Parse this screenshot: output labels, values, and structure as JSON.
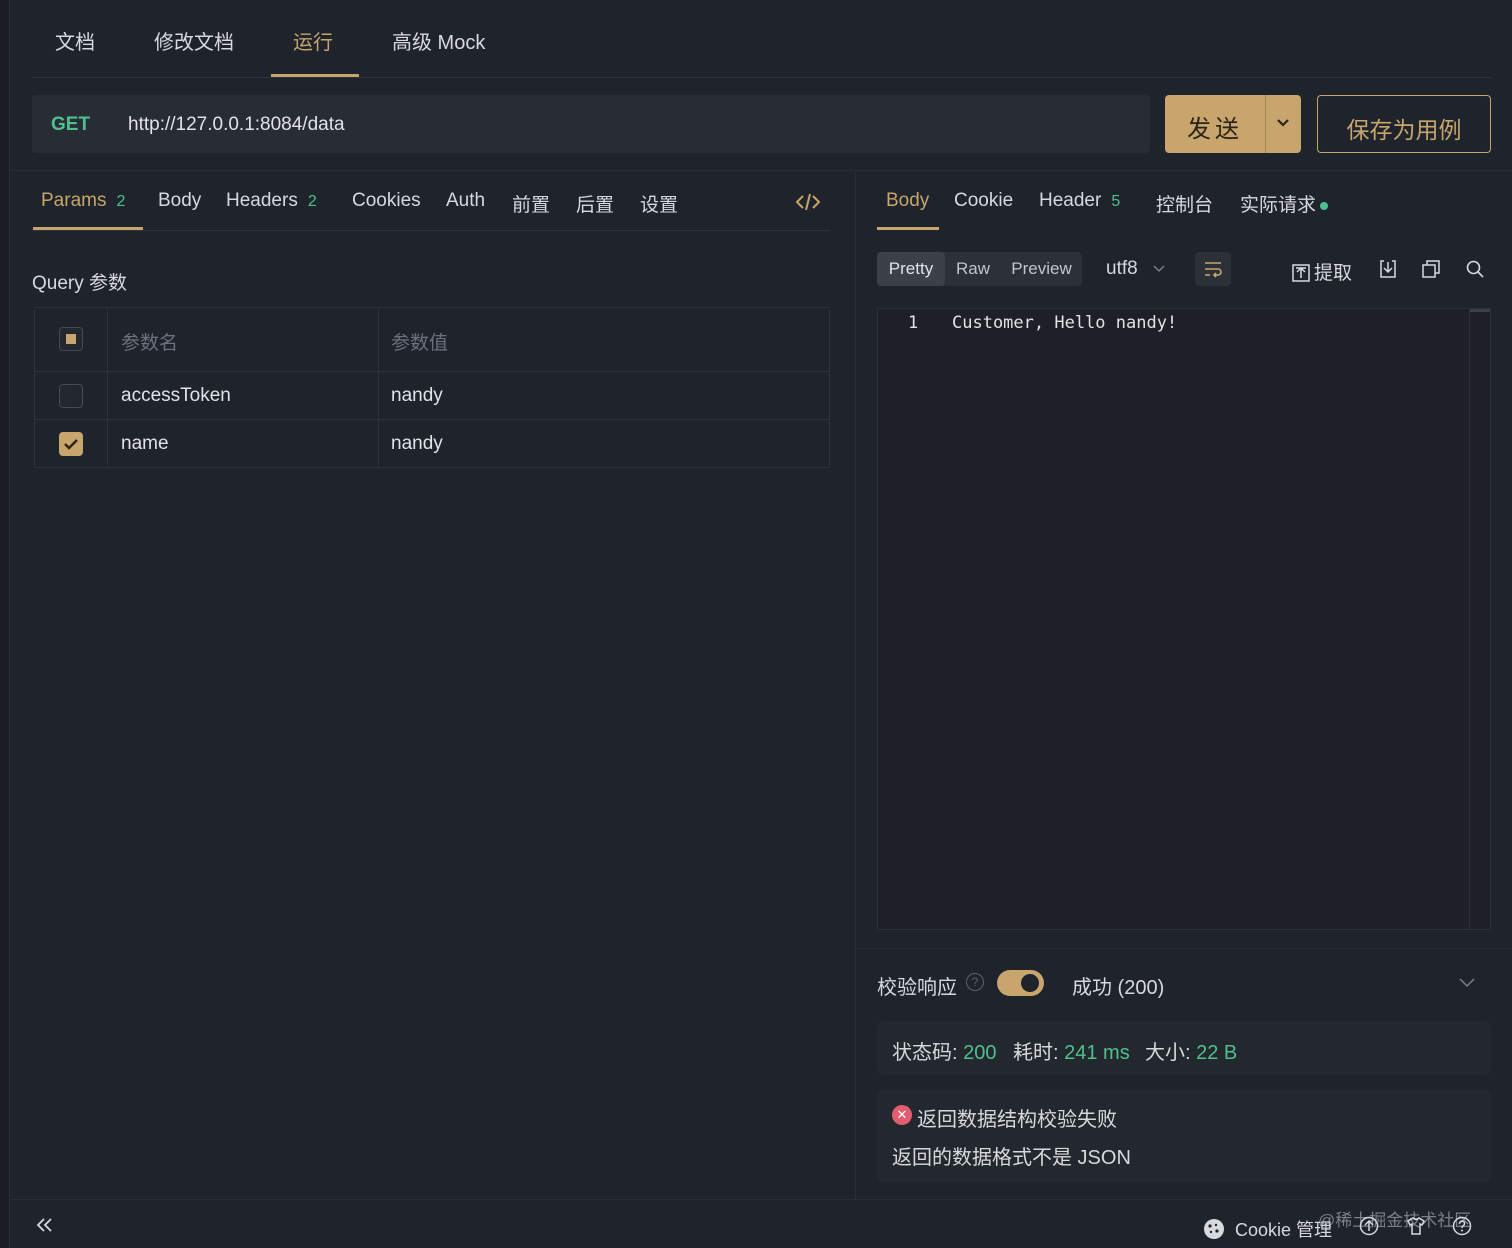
{
  "top_tabs": [
    "文档",
    "修改文档",
    "运行",
    "高级 Mock"
  ],
  "request": {
    "method": "GET",
    "url": "http://127.0.0.1:8084/data",
    "send_label": "发送",
    "save_label": "保存为用例"
  },
  "request_tabs": {
    "params": "Params",
    "params_count": "2",
    "body": "Body",
    "headers": "Headers",
    "headers_count": "2",
    "cookies": "Cookies",
    "auth": "Auth",
    "pre": "前置",
    "post": "后置",
    "settings": "设置"
  },
  "query": {
    "title": "Query 参数",
    "col_name": "参数名",
    "col_value": "参数值",
    "rows": [
      {
        "name": "accessToken",
        "value": "nandy",
        "checked": false
      },
      {
        "name": "name",
        "value": "nandy",
        "checked": true
      }
    ]
  },
  "response_tabs": {
    "body": "Body",
    "cookie": "Cookie",
    "header": "Header",
    "header_count": "5",
    "console": "控制台",
    "actual": "实际请求"
  },
  "toolbar": {
    "pretty": "Pretty",
    "raw": "Raw",
    "preview": "Preview",
    "encoding": "utf8",
    "extract": "提取"
  },
  "editor": {
    "line_number": "1",
    "content": "Customer, Hello nandy!"
  },
  "validation": {
    "label": "校验响应",
    "help": "?",
    "status": "成功 (200)",
    "enabled": true
  },
  "stats": {
    "status_label": "状态码:",
    "status_value": "200",
    "time_label": "耗时:",
    "time_value": "241 ms",
    "size_label": "大小:",
    "size_value": "22 B"
  },
  "error": {
    "title": "返回数据结构校验失败",
    "message": "返回的数据格式不是 JSON"
  },
  "footer": {
    "cookie_manager": "Cookie 管理",
    "watermark": "@稀土掘金技术社区"
  },
  "colors": {
    "accent": "#c7a56c",
    "success": "#4fc08d",
    "error": "#e05d6f",
    "background": "#1f232b"
  }
}
